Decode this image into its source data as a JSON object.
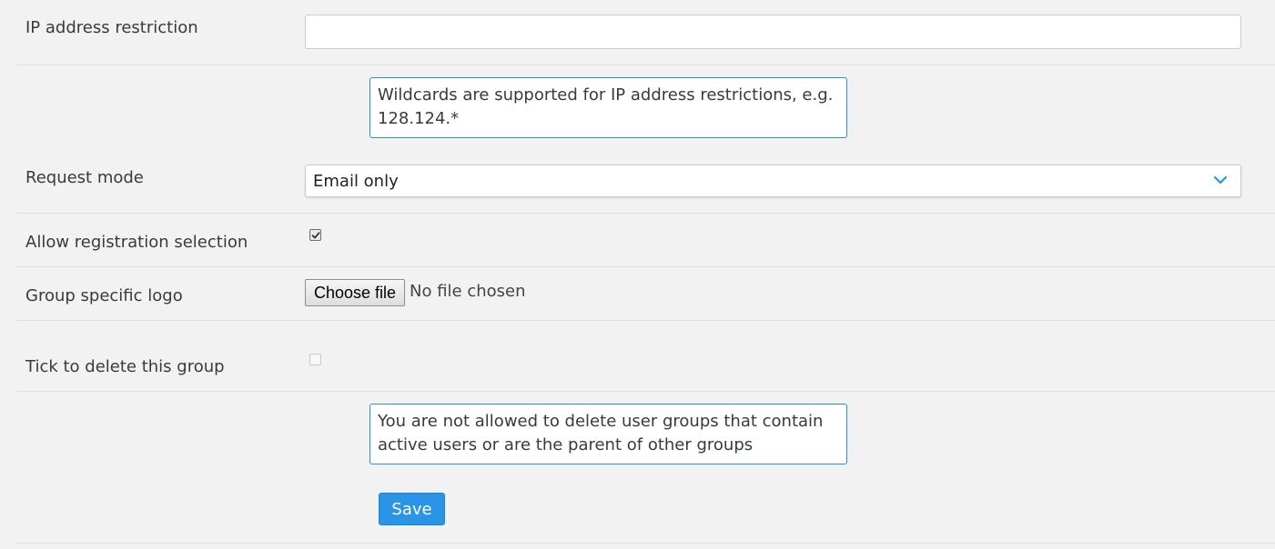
{
  "ip_restriction": {
    "label": "IP address restriction",
    "value": "",
    "placeholder": "",
    "help": "Wildcards are supported for IP address restrictions, e.g. 128.124.*"
  },
  "request_mode": {
    "label": "Request mode",
    "selected": "Email only"
  },
  "registration_selection": {
    "label": "Allow registration selection",
    "checked": true
  },
  "logo": {
    "label": "Group specific logo",
    "button_label": "Choose file",
    "status": "No file chosen"
  },
  "delete_group": {
    "label": "Tick to delete this group",
    "checked": false,
    "help": "You are not allowed to delete user groups that contain active users or are the parent of other groups"
  },
  "actions": {
    "save_label": "Save"
  },
  "colors": {
    "accent": "#2a95e6",
    "help_border": "#2d8fd5",
    "background": "#f2f2f2"
  }
}
